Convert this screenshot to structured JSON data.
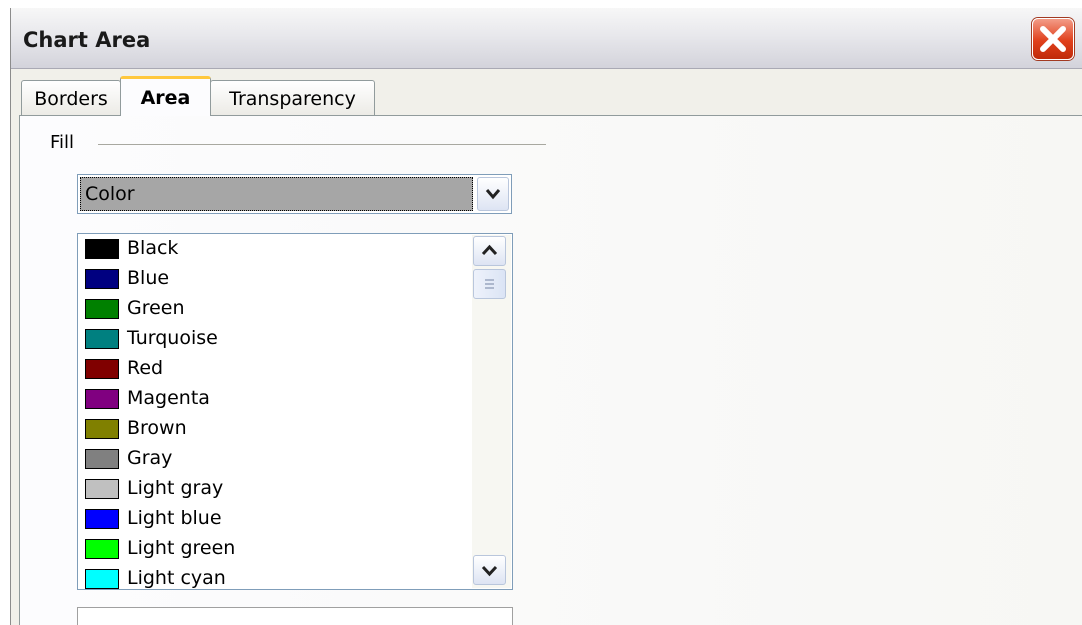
{
  "window": {
    "title": "Chart Area"
  },
  "tabs": [
    {
      "label": "Borders",
      "active": false
    },
    {
      "label": "Area",
      "active": true
    },
    {
      "label": "Transparency",
      "active": false
    }
  ],
  "fill": {
    "section_label": "Fill",
    "dropdown_value": "Color"
  },
  "colors": [
    {
      "name": "Black",
      "hex": "#000000"
    },
    {
      "name": "Blue",
      "hex": "#000080"
    },
    {
      "name": "Green",
      "hex": "#008000"
    },
    {
      "name": "Turquoise",
      "hex": "#008080"
    },
    {
      "name": "Red",
      "hex": "#800000"
    },
    {
      "name": "Magenta",
      "hex": "#800080"
    },
    {
      "name": "Brown",
      "hex": "#808000"
    },
    {
      "name": "Gray",
      "hex": "#808080"
    },
    {
      "name": "Light gray",
      "hex": "#c0c0c0"
    },
    {
      "name": "Light blue",
      "hex": "#0000ff"
    },
    {
      "name": "Light green",
      "hex": "#00ff00"
    },
    {
      "name": "Light cyan",
      "hex": "#00ffff"
    }
  ],
  "icons": {
    "close": "close-icon",
    "dropdown": "chevron-down-icon",
    "scroll_up": "chevron-up-icon",
    "scroll_down": "chevron-down-icon",
    "scroll_grip": "grip-icon"
  },
  "theme": {
    "accent_tab": "#ffc83c",
    "close_red": "#e0401c",
    "selection_gray": "#a6a6a6"
  }
}
